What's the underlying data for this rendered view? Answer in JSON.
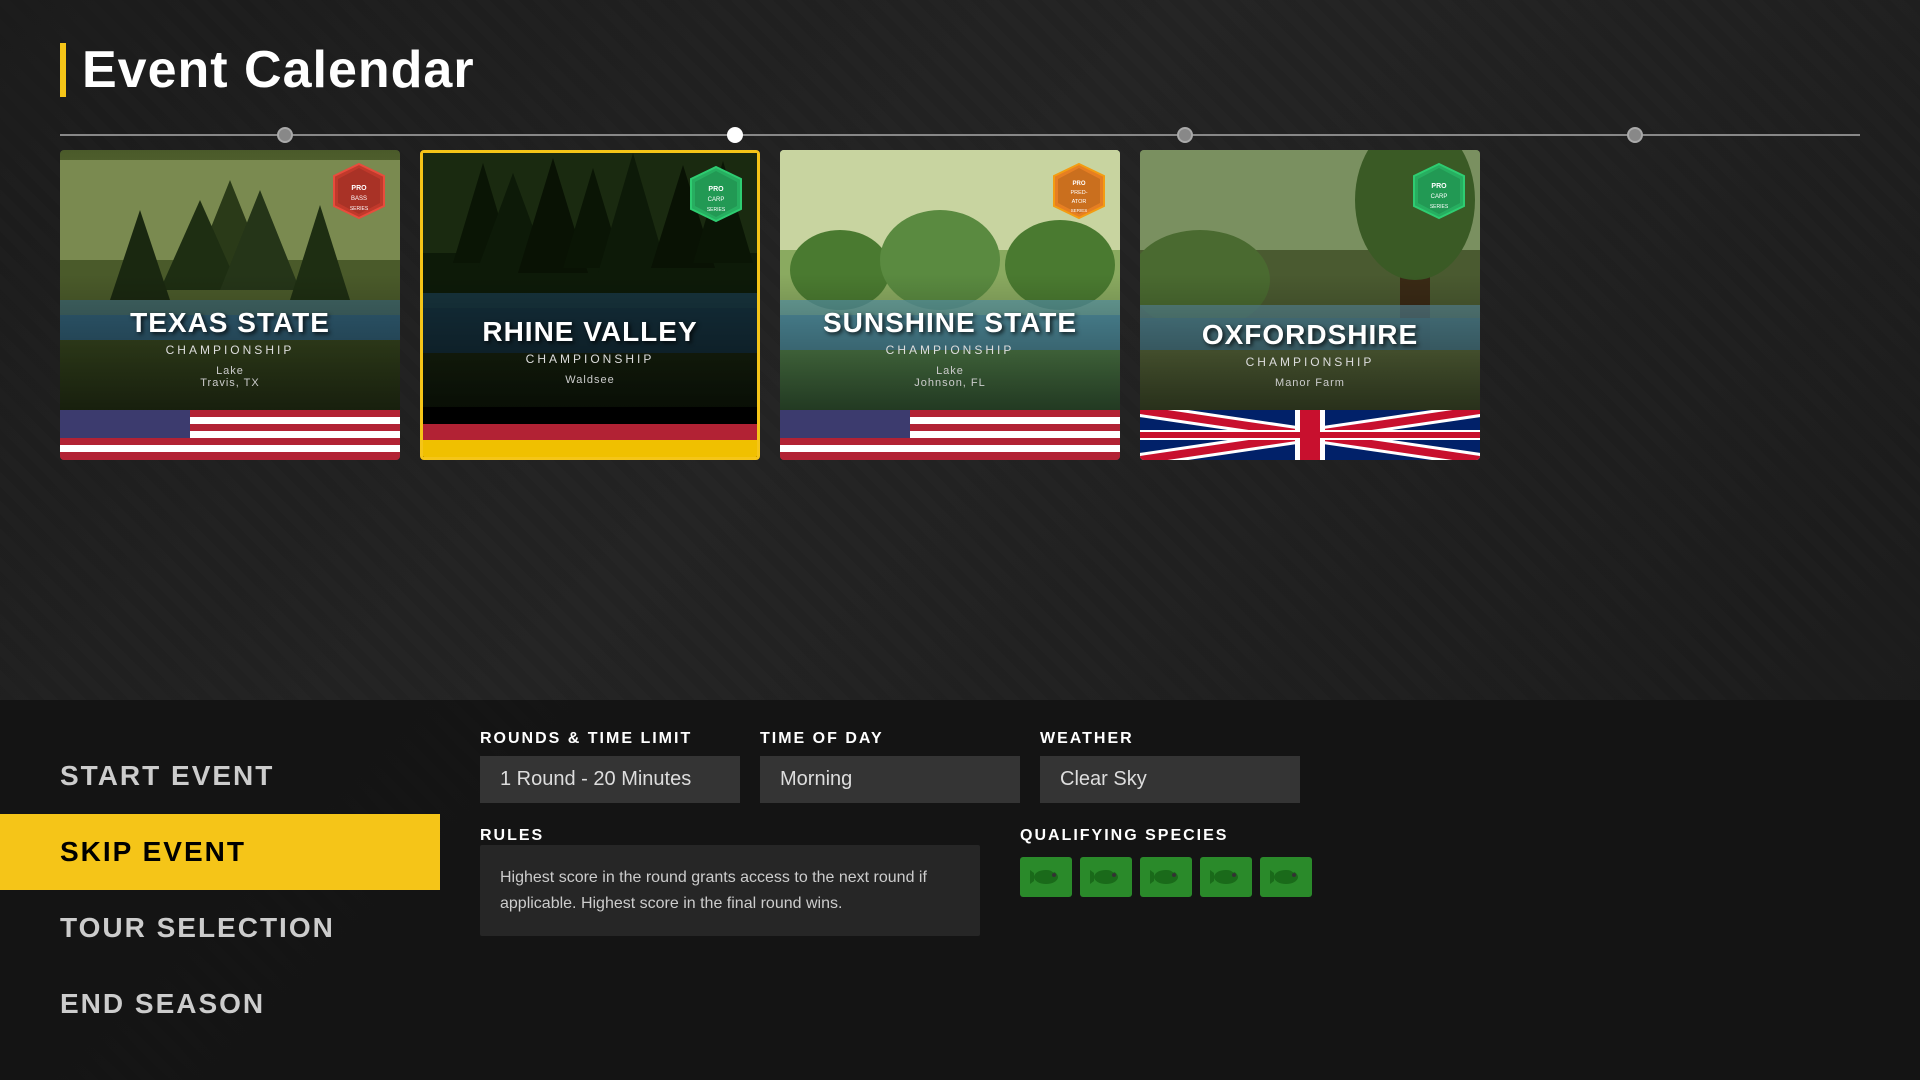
{
  "header": {
    "title": "Event Calendar",
    "accent_color": "#f5c518"
  },
  "timeline": {
    "dots": [
      {
        "id": 1,
        "active": false
      },
      {
        "id": 2,
        "active": true
      },
      {
        "id": 3,
        "active": false
      },
      {
        "id": 4,
        "active": false
      }
    ]
  },
  "cards": [
    {
      "id": "texas-state",
      "title": "Texas State",
      "subtitle": "Championship",
      "location_line1": "Lake",
      "location_line2": "Travis, TX",
      "series": "Pro Bass Series",
      "badge_color": "#c0392b",
      "selected": false,
      "theme": "texas"
    },
    {
      "id": "rhine-valley",
      "title": "Rhine Valley",
      "subtitle": "Championship",
      "location_line1": "Waldsee",
      "location_line2": "",
      "series": "Pro Carp Series",
      "badge_color": "#27ae60",
      "selected": true,
      "theme": "rhine"
    },
    {
      "id": "sunshine-state",
      "title": "Sunshine State",
      "subtitle": "Championship",
      "location_line1": "Lake",
      "location_line2": "Johnson, FL",
      "series": "Pro Predator Series",
      "badge_color": "#e67e22",
      "selected": false,
      "theme": "sunshine"
    },
    {
      "id": "oxfordshire",
      "title": "Oxfordshire",
      "subtitle": "Championship",
      "location_line1": "Manor Farm",
      "location_line2": "",
      "series": "Pro Carp Series",
      "badge_color": "#27ae60",
      "selected": false,
      "theme": "oxford"
    }
  ],
  "menu": {
    "items": [
      {
        "id": "start-event",
        "label": "Start Event",
        "active": false
      },
      {
        "id": "skip-event",
        "label": "Skip Event",
        "active": true
      },
      {
        "id": "tour-selection",
        "label": "Tour Selection",
        "active": false
      },
      {
        "id": "end-season",
        "label": "End Season",
        "active": false
      }
    ]
  },
  "event_info": {
    "rounds_label": "Rounds & Time Limit",
    "rounds_value": "1 Round - 20 Minutes",
    "time_label": "Time of Day",
    "time_value": "Morning",
    "weather_label": "Weather",
    "weather_value": "Clear Sky",
    "rules_label": "Rules",
    "rules_text": "Highest score in the round grants access to the next round if applicable. Highest score in the final round wins.",
    "qualifying_label": "Qualifying Species",
    "fish_count": 5
  }
}
